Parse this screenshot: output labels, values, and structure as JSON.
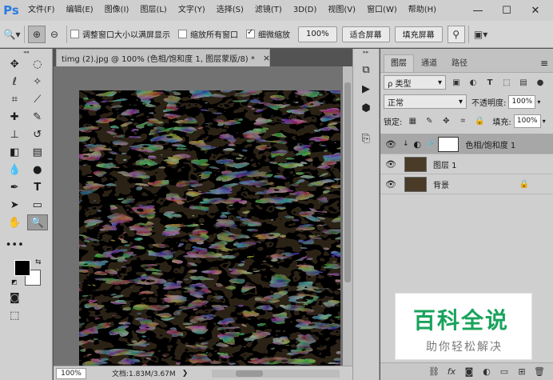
{
  "app": {
    "logo": "Ps"
  },
  "menu": [
    "文件(F)",
    "编辑(E)",
    "图像(I)",
    "图层(L)",
    "文字(Y)",
    "选择(S)",
    "滤镜(T)",
    "3D(D)",
    "视图(V)",
    "窗口(W)",
    "帮助(H)"
  ],
  "window_controls": {
    "minimize": "—",
    "maximize": "☐",
    "close": "✕"
  },
  "options": {
    "resize_windows_label": "调整窗口大小以满屏显示",
    "zoom_all_label": "缩放所有窗口",
    "scrubby_zoom_label": "细微缩放",
    "zoom_value": "100%",
    "fit_screen_label": "适合屏幕",
    "fill_screen_label": "填充屏幕"
  },
  "document": {
    "tab_title": "timg (2).jpg @ 100% (色相/饱和度 1, 图层蒙版/8) *",
    "close": "×",
    "zoom": "100%",
    "doc_size": "文档:1.83M/3.67M"
  },
  "layers_panel": {
    "tabs": [
      "图层",
      "通道",
      "路径"
    ],
    "filter_kind": "类型",
    "blend_mode": "正常",
    "opacity_label": "不透明度:",
    "opacity_value": "100%",
    "lock_label": "锁定:",
    "fill_label": "填充:",
    "fill_value": "100%",
    "layers": [
      {
        "name": "色相/饱和度 1",
        "selected": true
      },
      {
        "name": "图层 1",
        "selected": false
      },
      {
        "name": "背景",
        "selected": false,
        "locked": true
      }
    ]
  },
  "watermark": {
    "title": "百科全说",
    "subtitle": "助你轻松解决"
  },
  "colors": {
    "accent": "#2a7be0",
    "watermark_green": "#19a35c",
    "canvas_bg": "#2b2216"
  }
}
